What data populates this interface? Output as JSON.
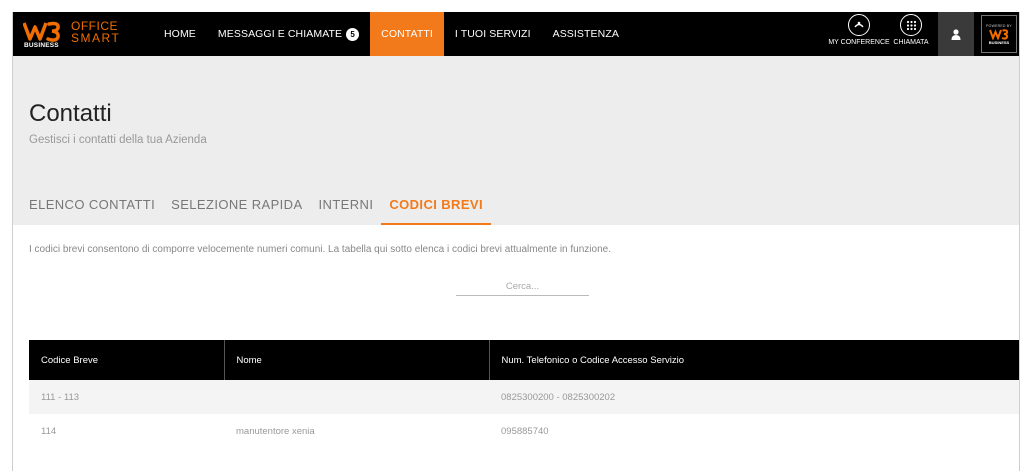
{
  "brand": {
    "mark": "W3",
    "business": "BUSINESS",
    "office": "OFFICE",
    "smart": "SMART"
  },
  "nav": {
    "items": [
      {
        "label": "HOME",
        "active": false
      },
      {
        "label": "MESSAGGI E CHIAMATE",
        "badge": "5",
        "active": false
      },
      {
        "label": "CONTATTI",
        "active": true
      },
      {
        "label": "I TUOI SERVIZI",
        "active": false
      },
      {
        "label": "ASSISTENZA",
        "active": false
      }
    ]
  },
  "tools": {
    "conference_label": "MY CONFERENCE",
    "call_label": "CHIAMATA",
    "conference_icon": "conference-icon",
    "call_icon": "dialpad-icon",
    "user_icon": "user-icon"
  },
  "powered": {
    "top": "POWERED BY",
    "bottom": "BUSINESS"
  },
  "page": {
    "title": "Contatti",
    "subtitle": "Gestisci i contatti della tua Azienda"
  },
  "tabs": [
    {
      "label": "ELENCO CONTATTI",
      "active": false
    },
    {
      "label": "SELEZIONE RAPIDA",
      "active": false
    },
    {
      "label": "INTERNI",
      "active": false
    },
    {
      "label": "CODICI BREVI",
      "active": true
    }
  ],
  "description": "I codici brevi consentono di comporre velocemente numeri comuni. La tabella qui sotto elenca i codici brevi attualmente in funzione.",
  "search": {
    "placeholder": "Cerca...",
    "value": ""
  },
  "table": {
    "columns": [
      "Codice Breve",
      "Nome",
      "Num. Telefonico o Codice Accesso Servizio"
    ],
    "rows": [
      [
        "111 - 113",
        "",
        "0825300200 - 0825300202"
      ],
      [
        "114",
        "manutentore xenia",
        "095885740"
      ]
    ]
  },
  "colors": {
    "accent": "#f27a1a",
    "topbar": "#000000",
    "header_bg": "#ededed"
  }
}
